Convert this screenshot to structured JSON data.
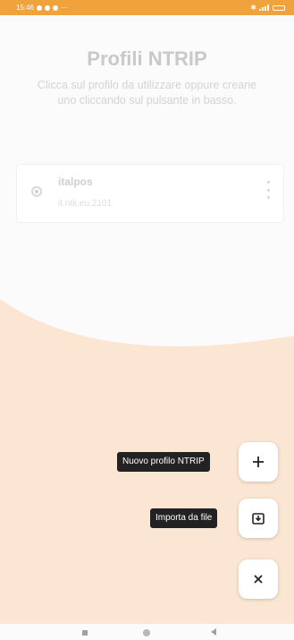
{
  "status_bar": {
    "time": "15:46",
    "accent": "#f0a23c"
  },
  "header": {
    "title": "Profili NTRIP",
    "subtitle": "Clicca sul profilo da utilizzare oppure creane uno cliccando sul pulsante in basso."
  },
  "profiles": [
    {
      "name": "italpos",
      "detail": "it.ntk.eu:2101",
      "selected": true
    }
  ],
  "actions": {
    "new_profile_label": "Nuovo profilo NTRIP",
    "import_label": "Importa da file"
  },
  "icons": {
    "new_profile": "plus-icon",
    "import": "import-file-icon",
    "close": "close-icon"
  },
  "colors": {
    "background": "#fbfbfb",
    "overlay_swoosh": "#fbe6d3",
    "tooltip": "#222222"
  }
}
